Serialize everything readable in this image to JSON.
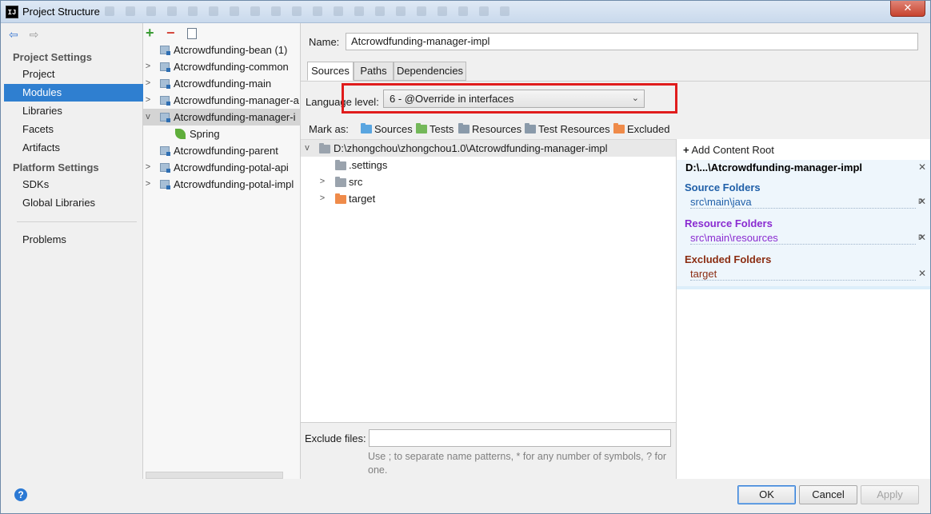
{
  "window": {
    "title": "Project Structure",
    "app_icon": "IJ",
    "close_glyph": "✕"
  },
  "nav": {
    "back_glyph": "⇦",
    "forward_glyph": "⇨",
    "project_settings_header": "Project Settings",
    "project_settings_items": [
      "Project",
      "Modules",
      "Libraries",
      "Facets",
      "Artifacts"
    ],
    "platform_settings_header": "Platform Settings",
    "platform_settings_items": [
      "SDKs",
      "Global Libraries"
    ],
    "problems": "Problems",
    "selected": "Modules"
  },
  "module_tree": {
    "toolbar": {
      "add": "+",
      "remove": "−"
    },
    "items": [
      {
        "label": "Atcrowdfunding-bean (1)",
        "expandable": false
      },
      {
        "label": "Atcrowdfunding-common",
        "expandable": true
      },
      {
        "label": "Atcrowdfunding-main",
        "expandable": true
      },
      {
        "label": "Atcrowdfunding-manager-a",
        "expandable": true
      },
      {
        "label": "Atcrowdfunding-manager-i",
        "expandable": true,
        "expanded": true,
        "selected": true
      },
      {
        "label": "Spring",
        "child": true
      },
      {
        "label": "Atcrowdfunding-parent",
        "expandable": false
      },
      {
        "label": "Atcrowdfunding-potal-api",
        "expandable": true
      },
      {
        "label": "Atcrowdfunding-potal-impl",
        "expandable": true
      }
    ]
  },
  "main": {
    "name_label": "Name:",
    "name_value": "Atcrowdfunding-manager-impl",
    "tabs": [
      "Sources",
      "Paths",
      "Dependencies"
    ],
    "active_tab": "Sources",
    "language_level_label": "Language level:",
    "language_level_value": "6 - @Override in interfaces",
    "mark_as_label": "Mark as:",
    "mark_as_options": [
      "Sources",
      "Tests",
      "Resources",
      "Test Resources",
      "Excluded"
    ],
    "file_tree": {
      "root": "D:\\zhongchou\\zhongchou1.0\\Atcrowdfunding-manager-impl",
      "children": [
        ".settings",
        "src",
        "target"
      ]
    },
    "exclude_files_label": "Exclude files:",
    "exclude_files_value": "",
    "exclude_hint": "Use ; to separate name patterns, * for any number of symbols, ? for one."
  },
  "content_roots": {
    "add_label": "Add Content Root",
    "root_path": "D:\\...\\Atcrowdfunding-manager-impl",
    "source_folders_title": "Source Folders",
    "source_folders": [
      "src\\main\\java"
    ],
    "resource_folders_title": "Resource Folders",
    "resource_folders": [
      "src\\main\\resources"
    ],
    "excluded_folders_title": "Excluded Folders",
    "excluded_folders": [
      "target"
    ],
    "properties_mark": "P"
  },
  "buttons": {
    "ok": "OK",
    "cancel": "Cancel",
    "apply": "Apply",
    "help": "?"
  },
  "colors": {
    "selection": "#2f7fd0",
    "highlight_box": "#e01c1c",
    "source_folder": "#1f5fa8",
    "resource_folder": "#8a2bd1",
    "excluded_folder": "#8b2d12"
  }
}
